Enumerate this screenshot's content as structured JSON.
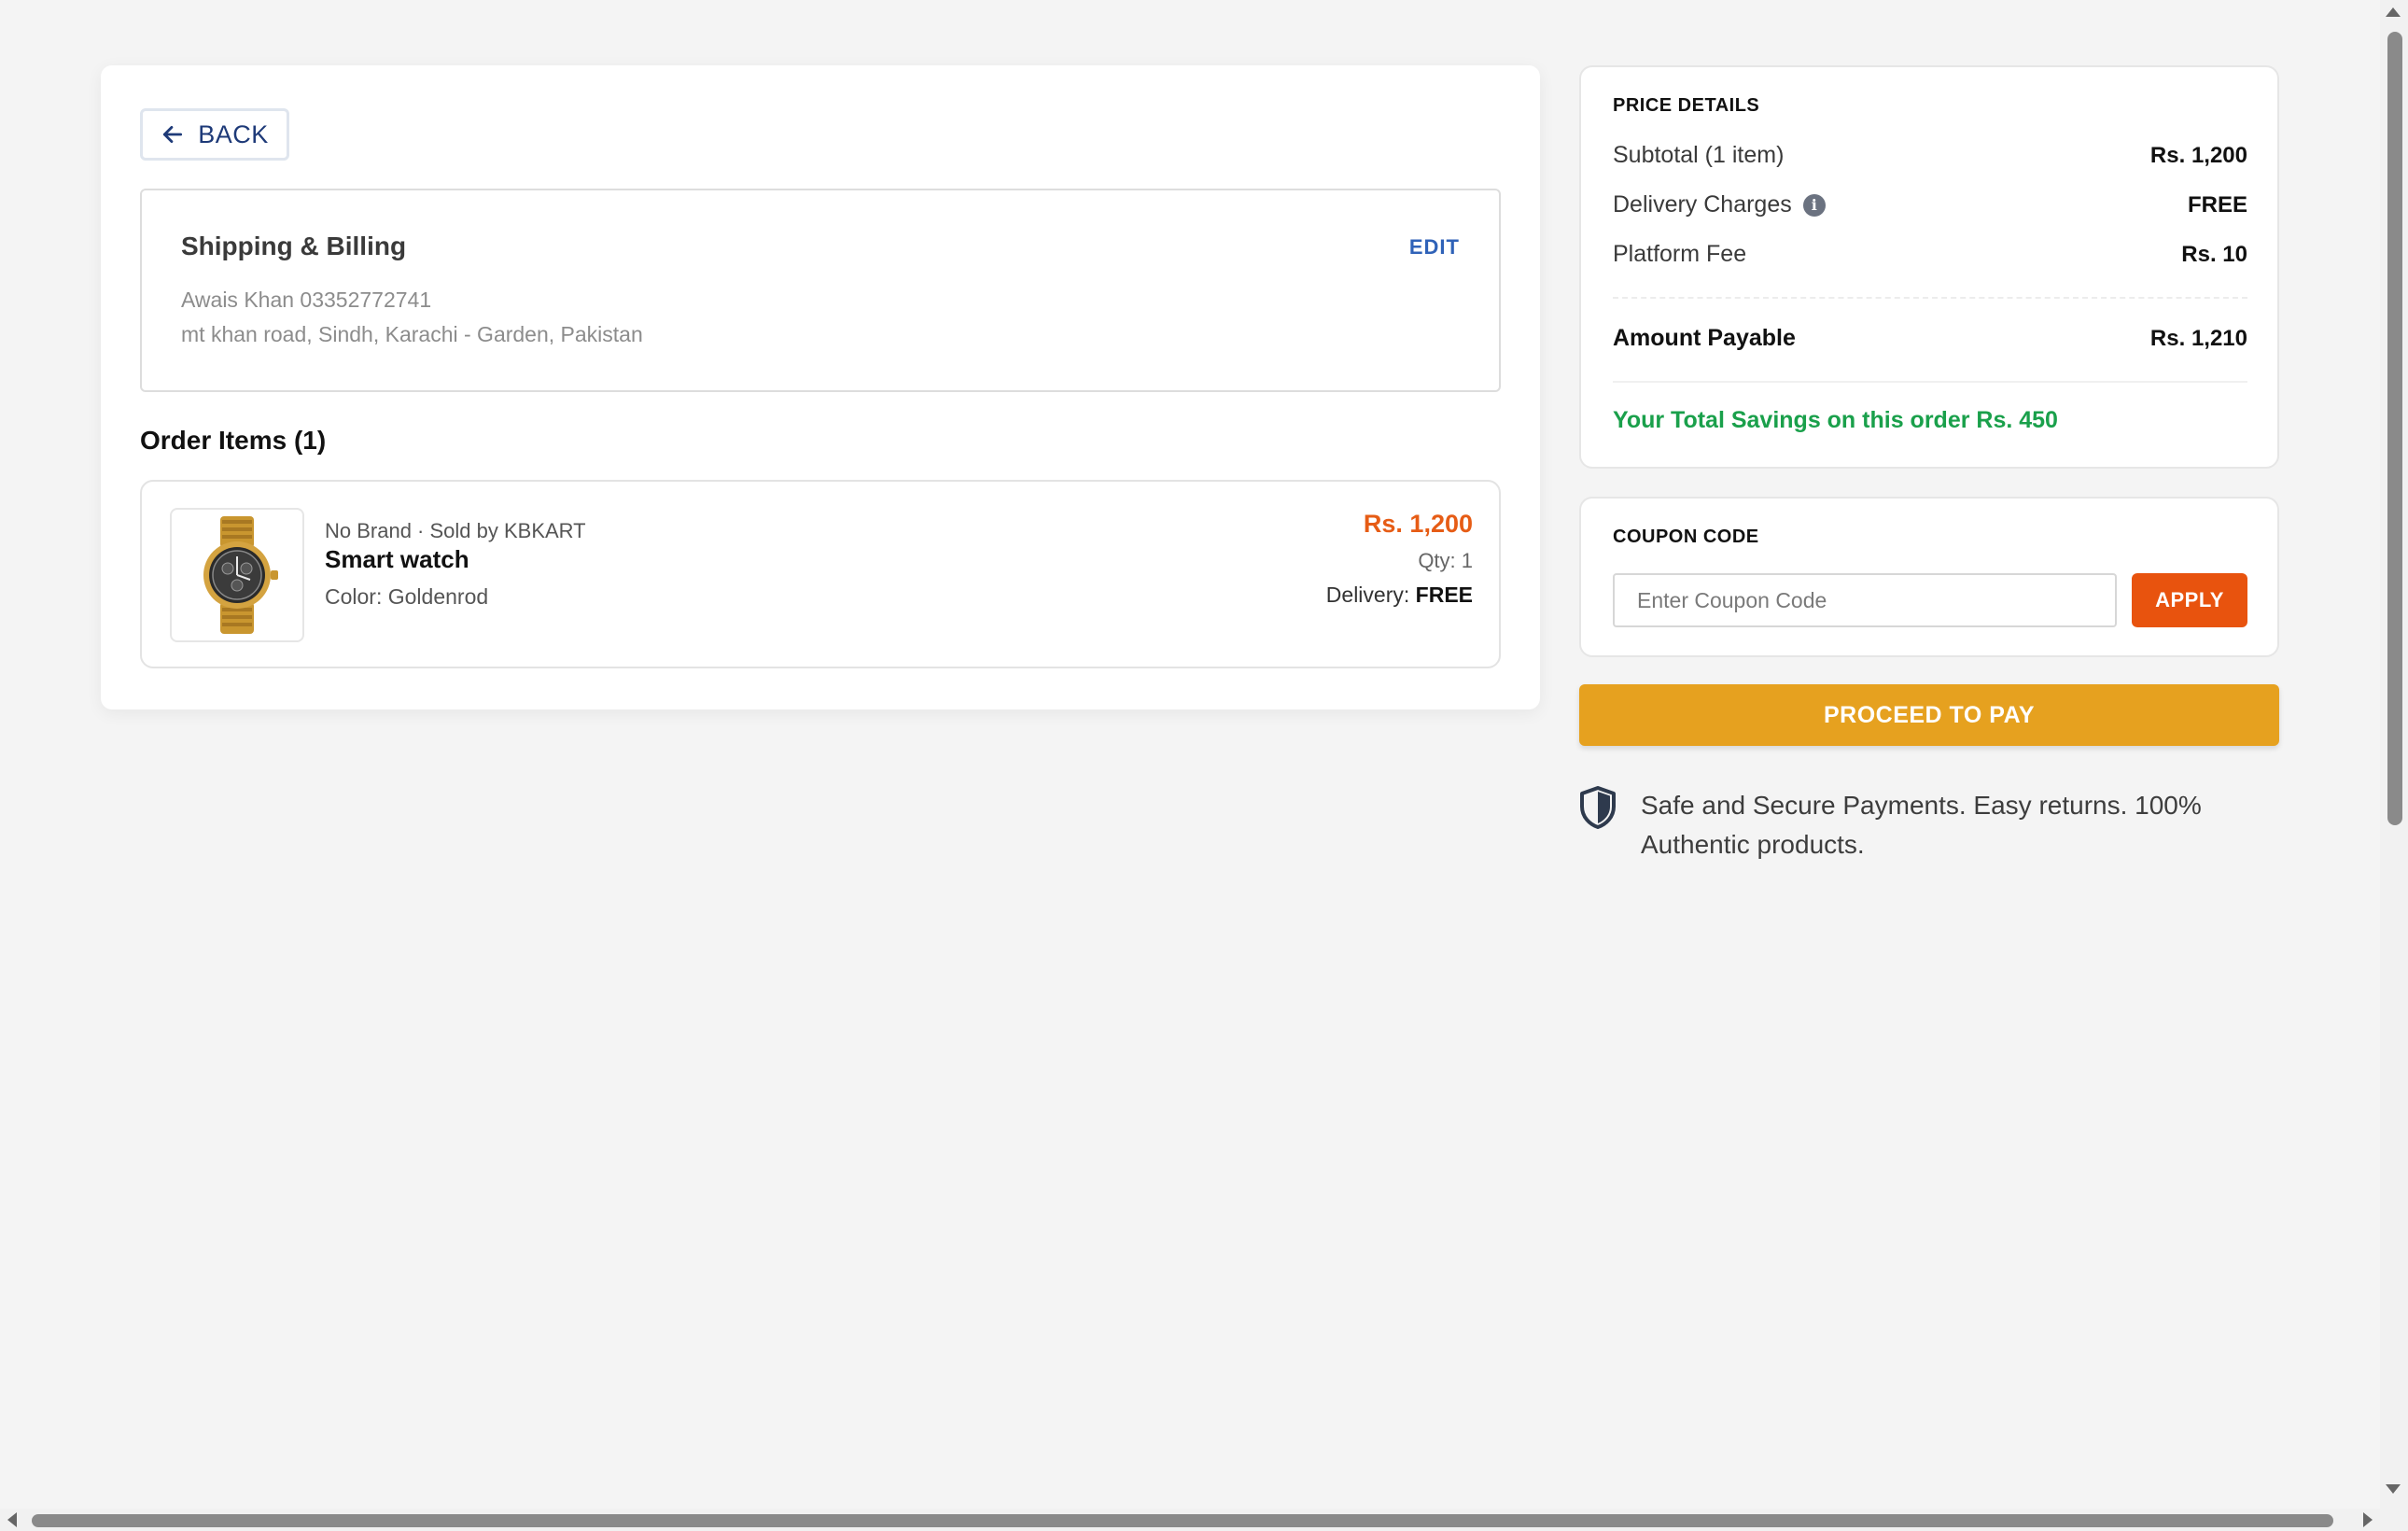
{
  "back_button": {
    "label": "BACK"
  },
  "shipping": {
    "title": "Shipping & Billing",
    "edit_label": "EDIT",
    "name_phone": "Awais Khan 03352772741",
    "address": "mt khan road, Sindh, Karachi - Garden, Pakistan"
  },
  "order_items": {
    "heading": "Order Items (1)",
    "items": [
      {
        "meta": "No Brand · Sold by KBKART",
        "name": "Smart watch",
        "color": "Color: Goldenrod",
        "price": "Rs. 1,200",
        "qty": "Qty: 1",
        "delivery_label": "Delivery:",
        "delivery_value": "FREE",
        "image_icon": "watch-icon"
      }
    ]
  },
  "price_details": {
    "heading": "PRICE DETAILS",
    "rows": [
      {
        "label": "Subtotal (1 item)",
        "value": "Rs. 1,200"
      },
      {
        "label": "Delivery Charges",
        "value": "FREE",
        "info_icon": "i"
      },
      {
        "label": "Platform Fee",
        "value": "Rs. 10"
      }
    ],
    "total_label": "Amount Payable",
    "total_value": "Rs. 1,210",
    "savings": "Your Total Savings on this order Rs. 450"
  },
  "coupon": {
    "heading": "COUPON CODE",
    "placeholder": "Enter Coupon Code",
    "value": "",
    "apply_label": "APPLY"
  },
  "proceed_button": {
    "label": "PROCEED TO PAY"
  },
  "secure_note": {
    "icon": "shield-icon",
    "text": "Safe and Secure Payments. Easy returns. 100% Authentic products."
  },
  "colors": {
    "accent_orange": "#e8530e",
    "price_orange": "#e65c15",
    "proceed_gold": "#e6a11f",
    "savings_green": "#1aa04b",
    "link_blue": "#2f62b8"
  }
}
